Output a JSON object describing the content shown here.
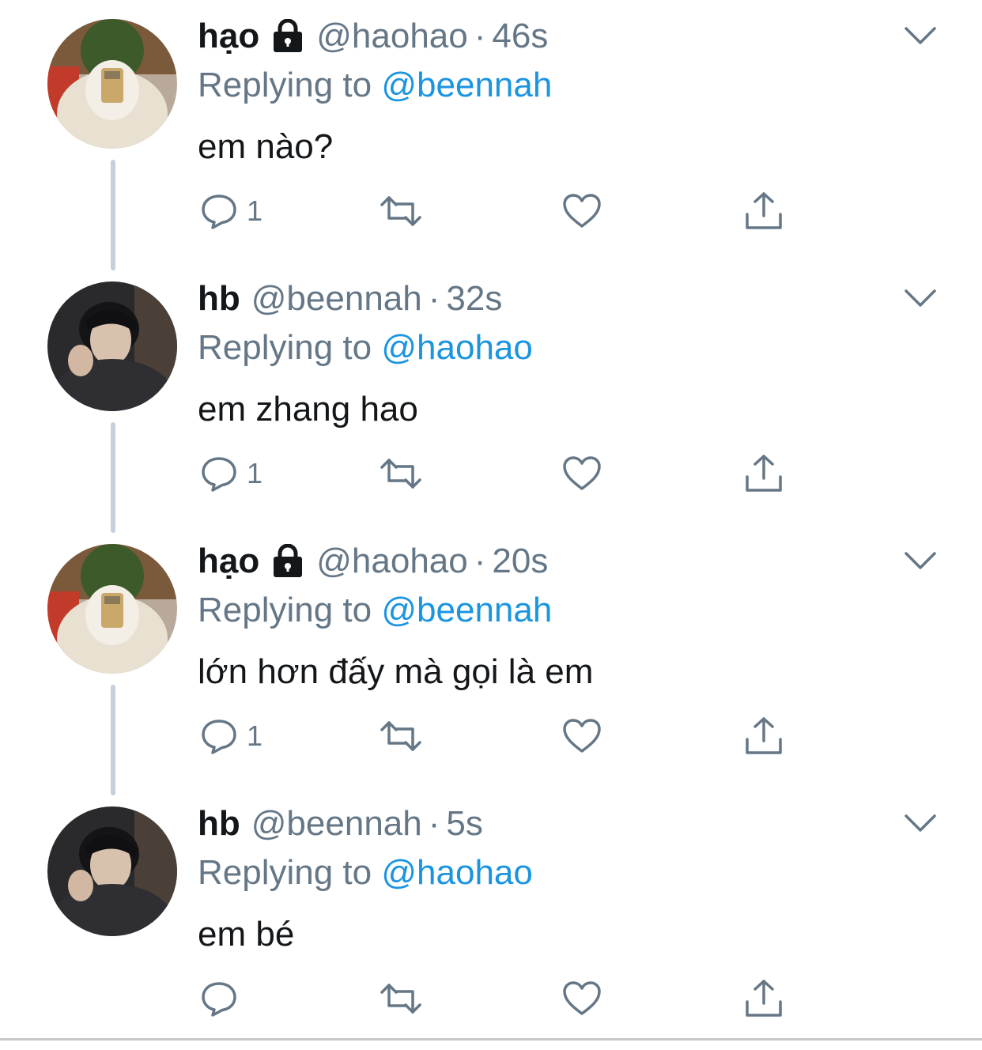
{
  "tweets": [
    {
      "name": "hạo",
      "protected": true,
      "handle": "@haohao",
      "separator": "·",
      "time": "46s",
      "replying_prefix": "Replying to",
      "replying_to": "@beennah",
      "text": "em nào?",
      "reply_count": "1",
      "avatar": "user-hao"
    },
    {
      "name": "hb",
      "protected": false,
      "handle": "@beennah",
      "separator": "·",
      "time": "32s",
      "replying_prefix": "Replying to",
      "replying_to": "@haohao",
      "text": "em zhang hao",
      "reply_count": "1",
      "avatar": "user-hb"
    },
    {
      "name": "hạo",
      "protected": true,
      "handle": "@haohao",
      "separator": "·",
      "time": "20s",
      "replying_prefix": "Replying to",
      "replying_to": "@beennah",
      "text": "lớn hơn đấy mà gọi là em",
      "reply_count": "1",
      "avatar": "user-hao"
    },
    {
      "name": "hb",
      "protected": false,
      "handle": "@beennah",
      "separator": "·",
      "time": "5s",
      "replying_prefix": "Replying to",
      "replying_to": "@haohao",
      "text": "em bé",
      "reply_count": "",
      "avatar": "user-hb"
    }
  ],
  "icons": {
    "reply": "reply-icon",
    "retweet": "retweet-icon",
    "like": "heart-icon",
    "share": "share-icon",
    "menu": "chevron-down-icon",
    "lock": "lock-icon"
  },
  "colors": {
    "text_primary": "#14171a",
    "text_secondary": "#657786",
    "link": "#1b95e0",
    "thread_line": "#c5d0da"
  }
}
